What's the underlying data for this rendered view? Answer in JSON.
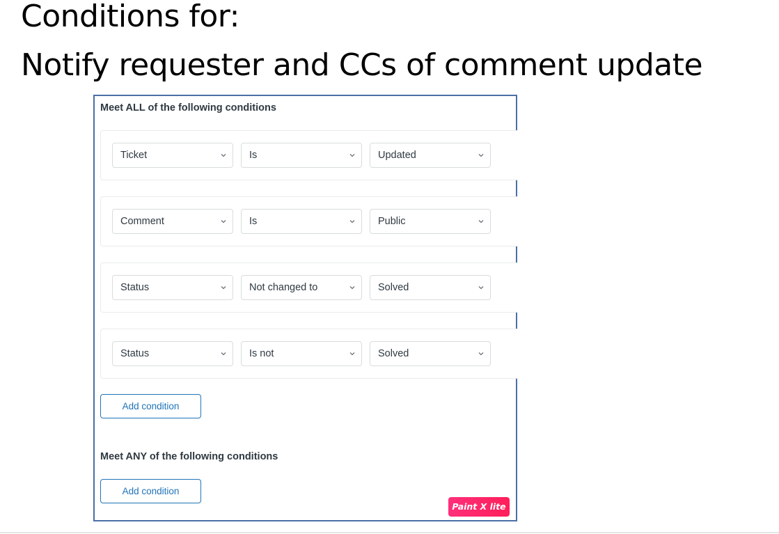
{
  "heading": {
    "line1": "Conditions for:",
    "line2": "Notify requester and CCs of comment update"
  },
  "all_section": {
    "title": "Meet ALL of the following conditions",
    "conditions": [
      {
        "field": "Ticket",
        "operator": "Is",
        "value": "Updated"
      },
      {
        "field": "Comment",
        "operator": "Is",
        "value": "Public"
      },
      {
        "field": "Status",
        "operator": "Not changed to",
        "value": "Solved"
      },
      {
        "field": "Status",
        "operator": "Is not",
        "value": "Solved"
      }
    ],
    "add_button_label": "Add condition"
  },
  "any_section": {
    "title": "Meet ANY of the following conditions",
    "add_button_label": "Add condition"
  },
  "watermark": "Paint X lite",
  "colors": {
    "panel_border": "#4a6fa5",
    "button_accent": "#1f73b7",
    "watermark_bg": "#ff2f7a"
  },
  "icons": [
    "chevron-down-icon"
  ]
}
